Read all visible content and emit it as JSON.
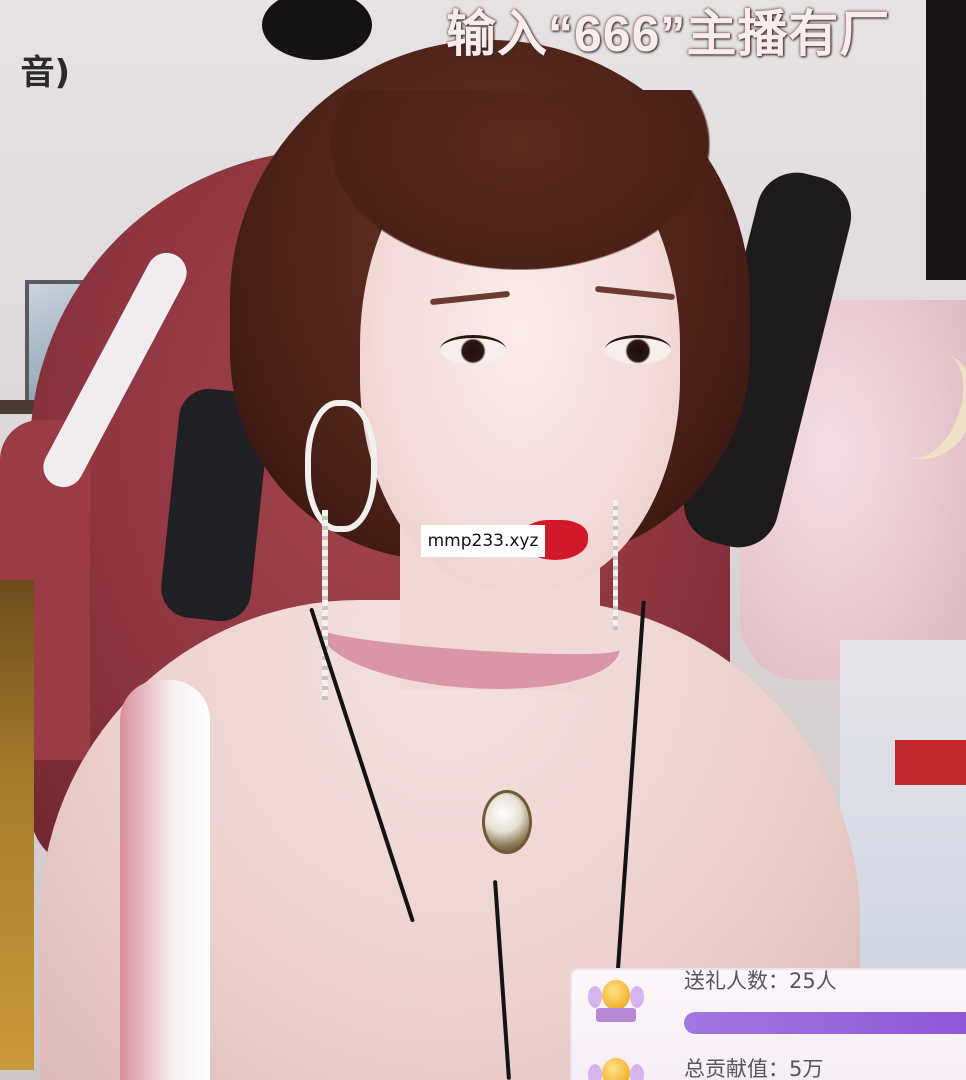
{
  "stream": {
    "top_banner": "输入“666”主播有厂",
    "top_left_partial": "音)",
    "watermark": "mmp233.xyz"
  },
  "stats_panel": {
    "gift_senders_label": "送礼人数：25人",
    "total_contribution_label": "总贡献值：5万",
    "progress_fraction": 1.0,
    "accent_color": "#8e57d9",
    "icon": "trophy-icon"
  }
}
